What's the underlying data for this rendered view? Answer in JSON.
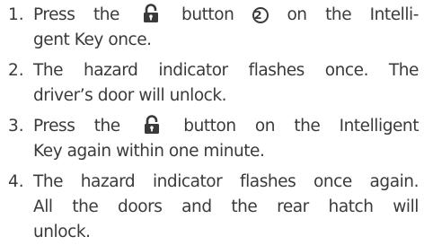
{
  "steps": [
    {
      "number": "1.",
      "line1": {
        "a": "Press the",
        "b": "button",
        "c": "2",
        "d": "on the Intelli-"
      },
      "line2": "gent Key once."
    },
    {
      "number": "2.",
      "line1": "The hazard indicator flashes once. The",
      "line2": "driver’s door will unlock."
    },
    {
      "number": "3.",
      "line1": {
        "a": "Press the",
        "b": "button on the Intelligent"
      },
      "line2": "Key again within one minute."
    },
    {
      "number": "4.",
      "line1": "The hazard indicator flashes once again.",
      "line2": "All the doors and the rear hatch will",
      "line3": "unlock."
    }
  ],
  "icons": {
    "lock_button": "lock-icon"
  },
  "colors": {
    "text": "#3a3a3a"
  }
}
